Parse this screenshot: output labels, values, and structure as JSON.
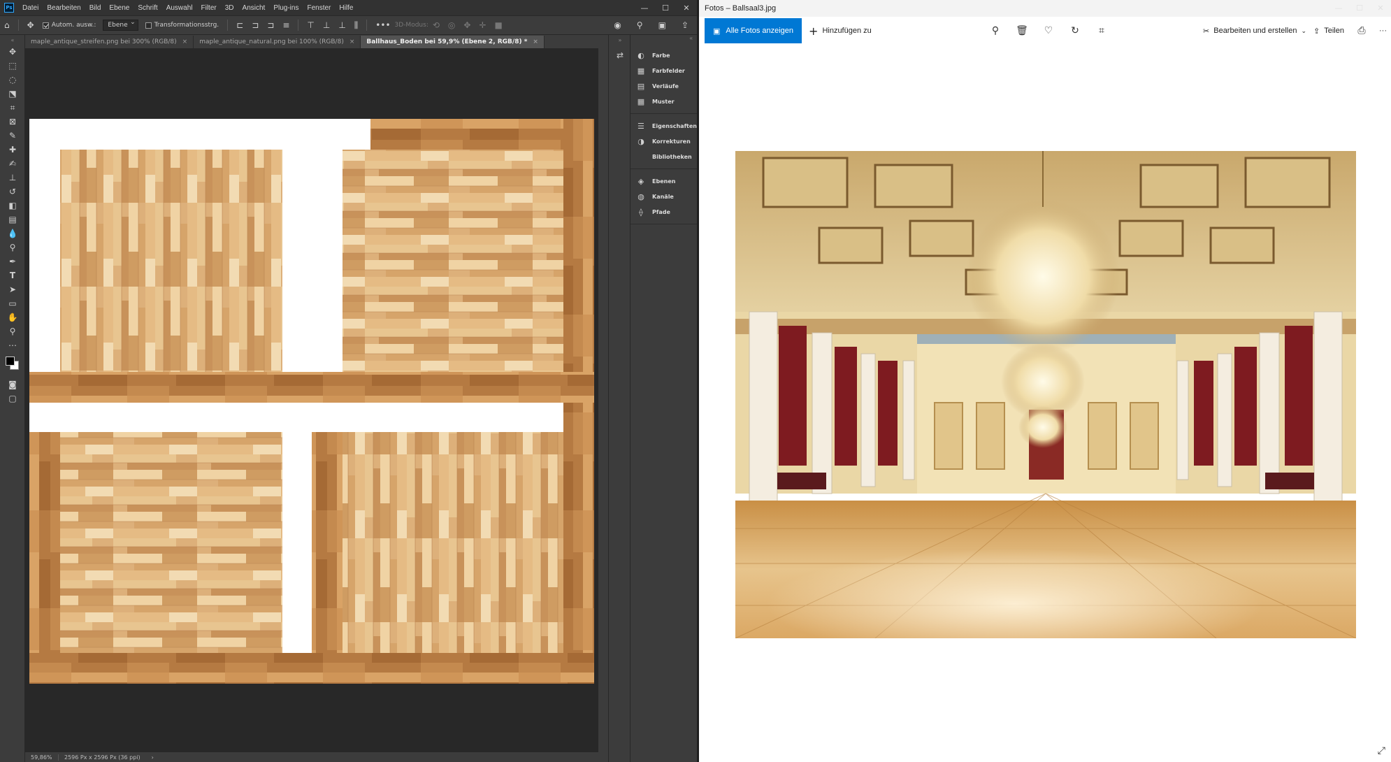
{
  "photoshop": {
    "logo": "Ps",
    "menu": [
      "Datei",
      "Bearbeiten",
      "Bild",
      "Ebene",
      "Schrift",
      "Auswahl",
      "Filter",
      "3D",
      "Ansicht",
      "Plug-ins",
      "Fenster",
      "Hilfe"
    ],
    "options": {
      "auto_select_label": "Autom. ausw.:",
      "auto_select_value": "Ebene",
      "transform_label": "Transformationsstrg.",
      "mode_3d_label": "3D-Modus:"
    },
    "tabs": [
      {
        "label": "maple_antique_streifen.png bei 300% (RGB/8)",
        "active": false
      },
      {
        "label": "maple_antique_natural.png bei 100% (RGB/8)",
        "active": false
      },
      {
        "label": "Ballhaus_Boden bei 59,9% (Ebene 2, RGB/8) *",
        "active": true
      }
    ],
    "tab_close": "×",
    "panels": {
      "group1": [
        "Farbe",
        "Farbfelder",
        "Verläufe",
        "Muster"
      ],
      "group2": [
        "Eigenschaften",
        "Korrekturen",
        "Bibliotheken"
      ],
      "group3": [
        "Ebenen",
        "Kanäle",
        "Pfade"
      ]
    },
    "panel_icons": {
      "Farbe": "palette-icon",
      "Farbfelder": "swatches-icon",
      "Verläufe": "gradient-icon",
      "Muster": "pattern-icon",
      "Eigenschaften": "properties-icon",
      "Korrekturen": "adjustments-icon",
      "Bibliotheken": "",
      "Ebenen": "layers-icon",
      "Kanäle": "channels-icon",
      "Pfade": "paths-icon"
    },
    "status": {
      "zoom": "59,86%",
      "doc_size": "2596 Px x 2596 Px (36 ppi)"
    },
    "colors": {
      "ui_dark": "#323232",
      "ui_panel": "#3c3c3c",
      "canvas_bg": "#282828",
      "wood_light": "#e3b57c",
      "wood_mid": "#c88e4f",
      "wood_dark": "#9a6532"
    }
  },
  "fotos": {
    "title": "Fotos – Ballsaal3.jpg",
    "all_photos_label": "Alle Fotos anzeigen",
    "add_label": "Hinzufügen zu",
    "edit_label": "Bearbeiten und erstellen",
    "share_label": "Teilen",
    "more_label": "···",
    "accent": "#0078d4",
    "tool_icons": [
      "zoom-icon",
      "delete-icon",
      "favorite-icon",
      "rotate-icon",
      "crop-icon"
    ]
  }
}
